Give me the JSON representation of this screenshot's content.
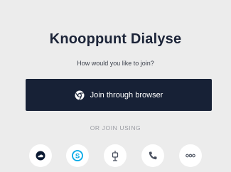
{
  "header": {
    "title": "Knooppunt Dialyse",
    "subtitle": "How would you like to join?"
  },
  "join": {
    "browser_label": "Join through browser"
  },
  "alternatives": {
    "divider_label": "OR JOIN USING",
    "options": [
      {
        "icon": "cloud-icon",
        "color": "#0b1a33"
      },
      {
        "icon": "skype-icon",
        "color": "#00a8e6"
      },
      {
        "icon": "lync-icon",
        "color": "#4b5260"
      },
      {
        "icon": "phone-icon",
        "color": "#4b5260"
      },
      {
        "icon": "more-icon",
        "color": "#4b5260"
      }
    ]
  },
  "colors": {
    "background": "#ececec",
    "primary_button": "#172136",
    "title": "#1c2438"
  }
}
